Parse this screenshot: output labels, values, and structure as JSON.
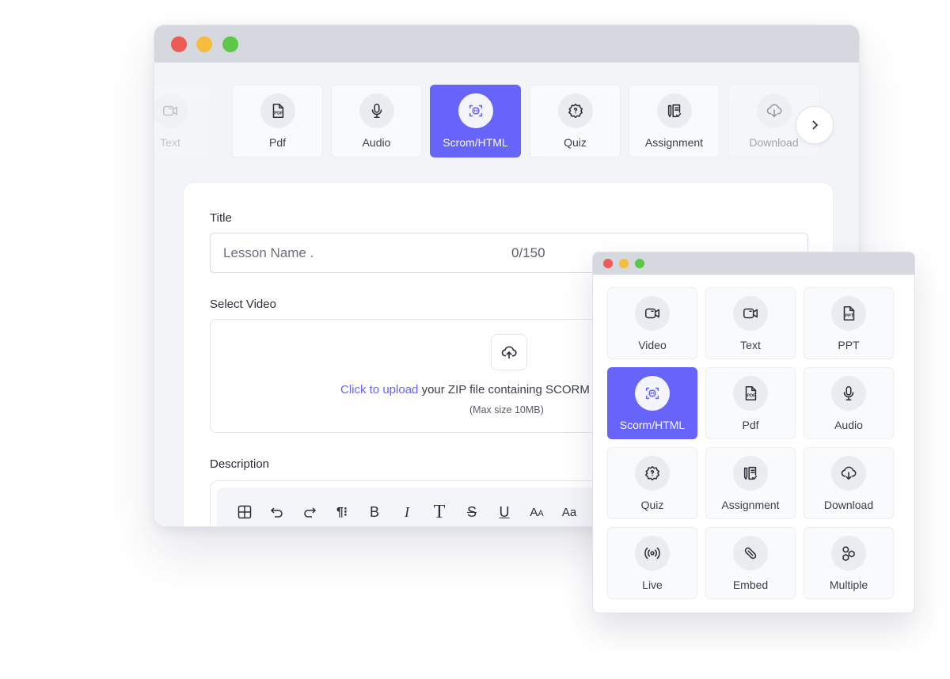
{
  "accent_color": "#6664fb",
  "main_window": {
    "tabs": [
      {
        "label": "Text",
        "icon": "video-icon",
        "state": "partial"
      },
      {
        "label": "Pdf",
        "icon": "pdf-icon"
      },
      {
        "label": "Audio",
        "icon": "microphone-icon"
      },
      {
        "label": "Scrom/HTML",
        "icon": "scorm-icon",
        "active": true
      },
      {
        "label": "Quiz",
        "icon": "quiz-icon"
      },
      {
        "label": "Assignment",
        "icon": "assignment-icon"
      },
      {
        "label": "Download",
        "icon": "cloud-download-icon",
        "state": "faded"
      }
    ],
    "form": {
      "title_label": "Title",
      "title_placeholder": "Lesson Name .",
      "title_count": "0/150",
      "video_label": "Select Video",
      "upload_link": "Click to upload",
      "upload_text": "your ZIP file containing SCORM",
      "upload_hint": "(Max size 10MB)",
      "description_label": "Description",
      "toolbar": [
        "table",
        "undo",
        "redo",
        "paragraph",
        "bold",
        "italic",
        "text",
        "strikethrough",
        "underline",
        "font-size",
        "font-case"
      ]
    }
  },
  "popup": {
    "items": [
      {
        "label": "Video",
        "icon": "video-icon"
      },
      {
        "label": "Text",
        "icon": "video-icon"
      },
      {
        "label": "PPT",
        "icon": "ppt-icon"
      },
      {
        "label": "Scorm/HTML",
        "icon": "scorm-icon",
        "active": true
      },
      {
        "label": "Pdf",
        "icon": "pdf-icon"
      },
      {
        "label": "Audio",
        "icon": "microphone-icon"
      },
      {
        "label": "Quiz",
        "icon": "quiz-icon"
      },
      {
        "label": "Assignment",
        "icon": "assignment-icon"
      },
      {
        "label": "Download",
        "icon": "cloud-download-icon"
      },
      {
        "label": "Live",
        "icon": "live-icon"
      },
      {
        "label": "Embed",
        "icon": "embed-icon"
      },
      {
        "label": "Multiple",
        "icon": "multiple-icon"
      }
    ]
  }
}
